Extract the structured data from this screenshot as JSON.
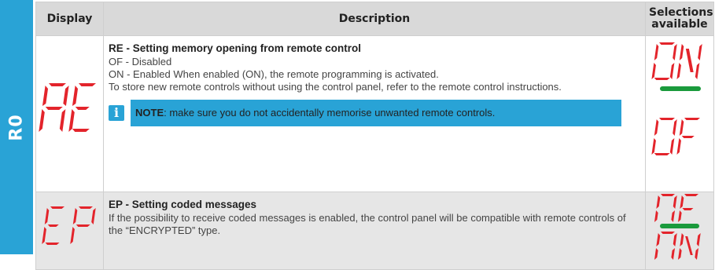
{
  "side_tab": {
    "label": "R0"
  },
  "header": {
    "display": "Display",
    "description": "Description",
    "selections": "Selections available"
  },
  "rows": [
    {
      "display_code": "RE",
      "title": "RE - Setting memory opening from remote control",
      "lines": [
        "OF - Disabled",
        "ON - Enabled When enabled (ON), the remote programming is activated.",
        "To store new remote controls without using the control panel, refer to the remote control instructions."
      ],
      "note_label": "NOTE",
      "note_text": ": make sure you do not accidentally memorise unwanted remote controls.",
      "selections": [
        "ON",
        "OF"
      ],
      "default_selection": "ON"
    },
    {
      "display_code": "EP",
      "title": "EP - Setting coded messages",
      "lines": [
        "If the possibility to receive coded messages is enabled, the control panel will be compatible with remote controls of the “ENCRYPTED” type."
      ],
      "selections": [
        "OF",
        "ON"
      ],
      "default_selection": "OF"
    }
  ],
  "colors": {
    "accent": "#29a3d6",
    "segment": "#e3242b",
    "default_bar": "#1a9a3c"
  }
}
